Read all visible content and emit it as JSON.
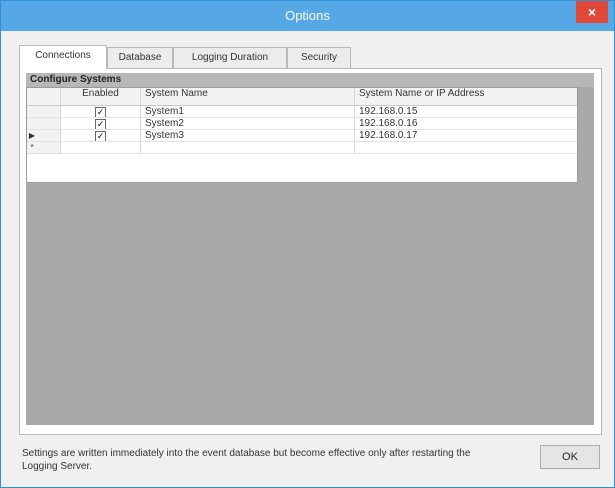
{
  "window": {
    "title": "Options",
    "close_glyph": "×",
    "accent_color": "#55a7e6",
    "close_color": "#e0483a"
  },
  "tabs": [
    {
      "label": "Connections",
      "active": true
    },
    {
      "label": "Database",
      "active": false
    },
    {
      "label": "Logging Duration",
      "active": false
    },
    {
      "label": "Security",
      "active": false
    }
  ],
  "group": {
    "title": "Configure Systems"
  },
  "grid": {
    "columns": [
      "Enabled",
      "System Name",
      "System Name or IP Address"
    ],
    "rows": [
      {
        "marker": "",
        "enabled": "✓",
        "name": "System1",
        "address": "192.168.0.15"
      },
      {
        "marker": "",
        "enabled": "✓",
        "name": "System2",
        "address": "192.168.0.16"
      },
      {
        "marker": "▶",
        "enabled": "✓",
        "name": "System3",
        "address": "192.168.0.17"
      }
    ],
    "new_row_marker": "*"
  },
  "footer": {
    "note": "Settings are written immediately into the event database but become effective only after restarting the Logging Server.",
    "ok_label": "OK"
  }
}
